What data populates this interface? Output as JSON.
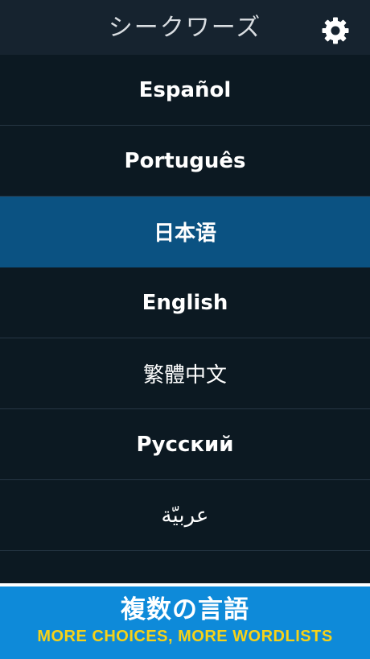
{
  "header": {
    "title": "シークワーズ",
    "settings_icon": "gear-icon"
  },
  "languages": [
    {
      "label": "Español"
    },
    {
      "label": "Português"
    },
    {
      "label": "日本语",
      "selected": true
    },
    {
      "label": "English"
    },
    {
      "label": "繁體中文"
    },
    {
      "label": "Русский"
    },
    {
      "label": "عربيّة"
    },
    {
      "label": ""
    }
  ],
  "banner": {
    "title": "複数の言語",
    "subtitle": "MORE CHOICES, MORE WORDLISTS"
  },
  "colors": {
    "header_bg": "#16232f",
    "list_bg": "#0c1922",
    "selected_row": "#0b5282",
    "banner_bg": "#0e8ad9",
    "banner_subtitle": "#f7d217"
  }
}
